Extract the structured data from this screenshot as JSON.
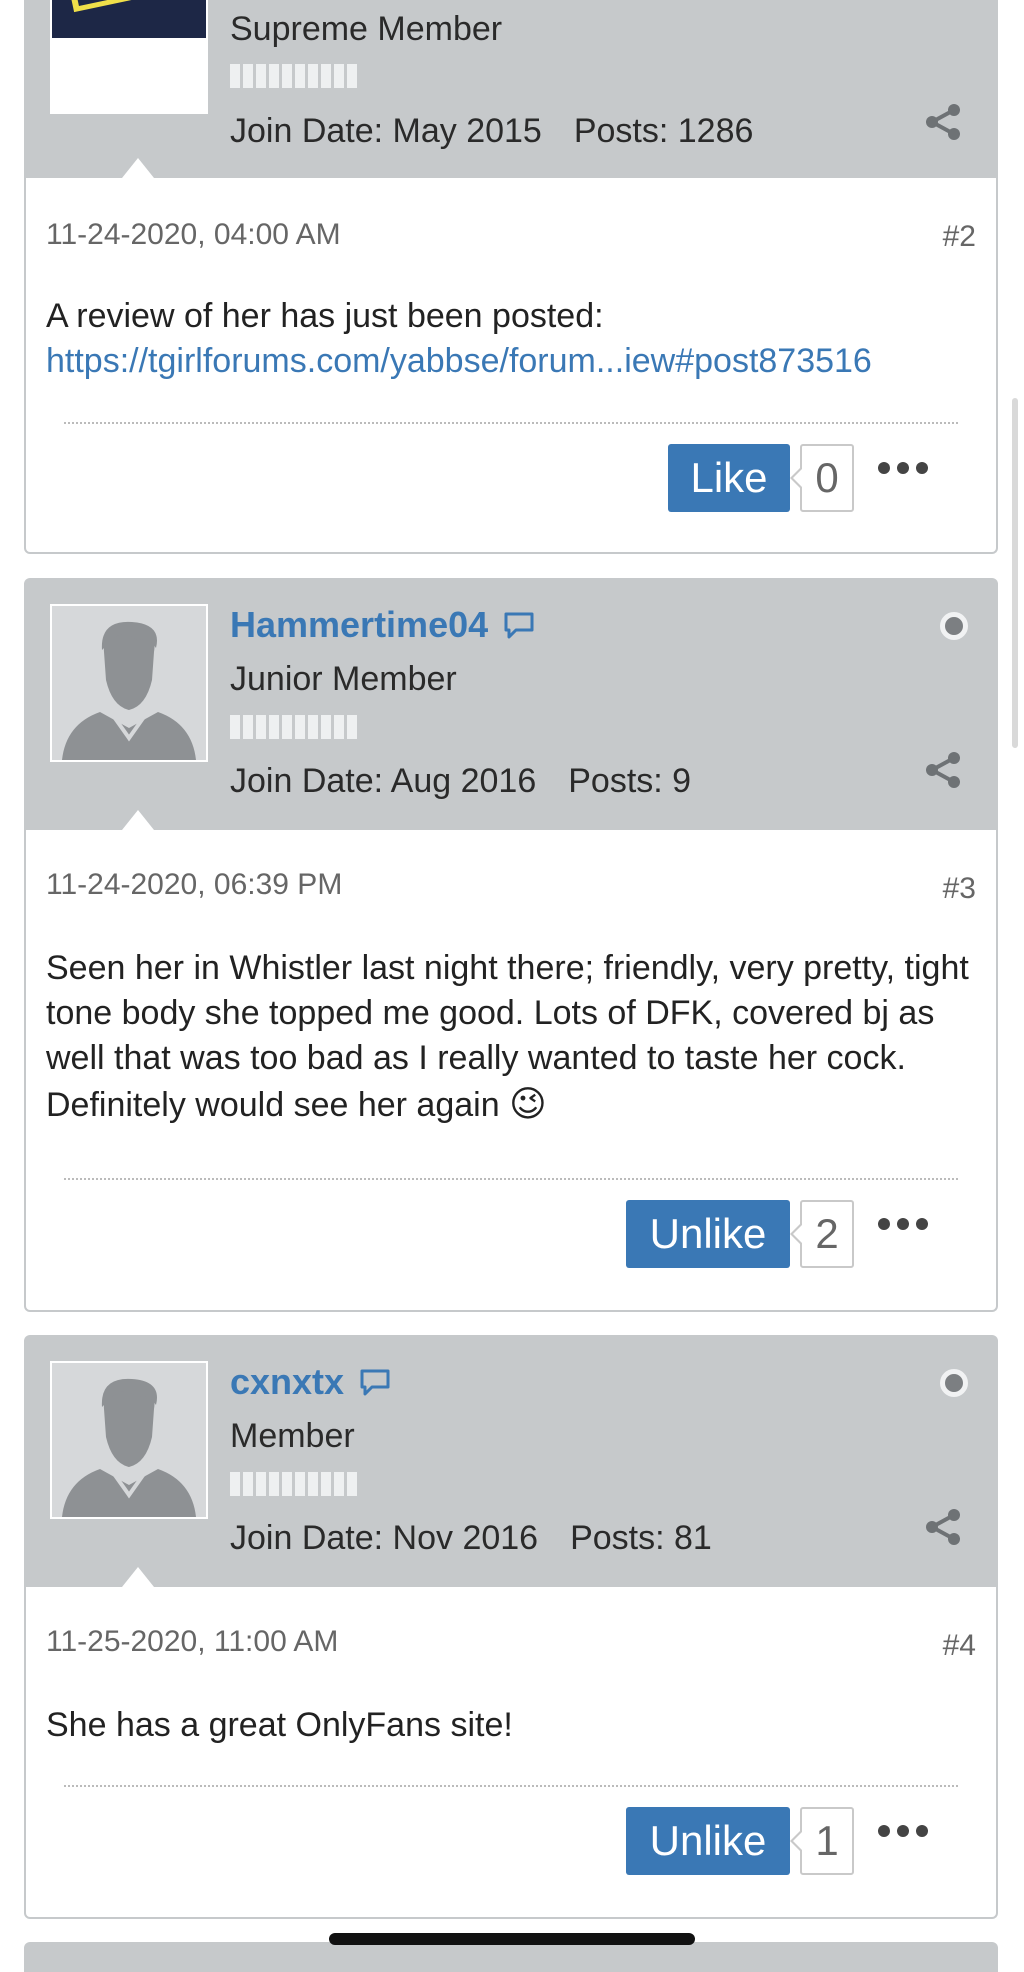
{
  "posts": [
    {
      "username": "",
      "title": "Supreme Member",
      "join_date": "Join Date: May 2015",
      "posts_count": "Posts: 1286",
      "date": "11-24-2020, 04:00 AM",
      "number": "#2",
      "text": "A review of her has just been posted:",
      "link": "https://tgirlforums.com/yabbse/forum...iew#post873516",
      "like_label": "Like",
      "like_count": "0"
    },
    {
      "username": "Hammertime04",
      "title": "Junior Member",
      "join_date": "Join Date: Aug 2016",
      "posts_count": "Posts: 9",
      "date": "11-24-2020, 06:39 PM",
      "number": "#3",
      "text": "Seen her in Whistler last night there; friendly, very pretty, tight tone body she topped me good. Lots of DFK, covered bj as well that was too bad as I really wanted to taste her cock. Definitely would see her again",
      "emoji": "😉",
      "like_label": "Unlike",
      "like_count": "2"
    },
    {
      "username": "cxnxtx",
      "title": "Member",
      "join_date": "Join Date: Nov 2016",
      "posts_count": "Posts: 81",
      "date": "11-25-2020, 11:00 AM",
      "number": "#4",
      "text": "She has a great OnlyFans site!",
      "like_label": "Unlike",
      "like_count": "1"
    }
  ],
  "colors": {
    "header_bg": "#c6c9cb",
    "accent": "#3a78b5",
    "text": "#2a2a2a"
  }
}
